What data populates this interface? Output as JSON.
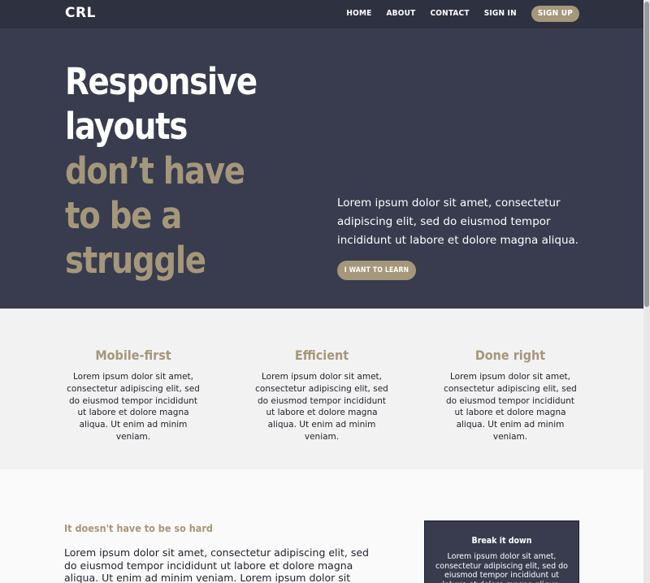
{
  "header": {
    "logo": "CRL",
    "nav": [
      "HOME",
      "ABOUT",
      "CONTACT",
      "SIGN IN"
    ],
    "cta": "SIGN UP"
  },
  "hero": {
    "title_white": [
      "Responsive",
      "layouts"
    ],
    "title_gold": [
      "don’t have",
      "to be a",
      "struggle"
    ],
    "text": "Lorem ipsum dolor sit amet, consectetur adipiscing elit, sed do eiusmod tempor incididunt ut labore et dolore magna aliqua.",
    "button": "I WANT TO LEARN"
  },
  "features": [
    {
      "title": "Mobile-first",
      "text": "Lorem ipsum dolor sit amet, consectetur adipiscing elit, sed do eiusmod tempor incididunt ut labore et dolore magna aliqua. Ut enim ad minim veniam."
    },
    {
      "title": "Efficient",
      "text": "Lorem ipsum dolor sit amet, consectetur adipiscing elit, sed do eiusmod tempor incididunt ut labore et dolore magna aliqua. Ut enim ad minim veniam."
    },
    {
      "title": "Done right",
      "text": "Lorem ipsum dolor sit amet, consectetur adipiscing elit, sed do eiusmod tempor incididunt ut labore et dolore magna aliqua. Ut enim ad minim veniam."
    }
  ],
  "article": {
    "heading": "It doesn't have to be so hard",
    "body": "Lorem ipsum dolor sit amet, consectetur adipiscing elit, sed do eiusmod tempor incididunt ut labore et dolore magna aliqua. Ut enim ad minim veniam. Lorem ipsum dolor sit amet, consectetur"
  },
  "sidebar_card": {
    "title": "Break it down",
    "text": "Lorem ipsum dolor sit amet, consectetur adipiscing elit, sed do eiusmod tempor incididunt ut labore et dolore magna aliqua."
  },
  "colors": {
    "header_bg": "#2e3140",
    "hero_bg": "#383c4e",
    "accent": "#a5977a",
    "features_bg": "#f2f2f2",
    "page_bg": "#fafafa"
  }
}
